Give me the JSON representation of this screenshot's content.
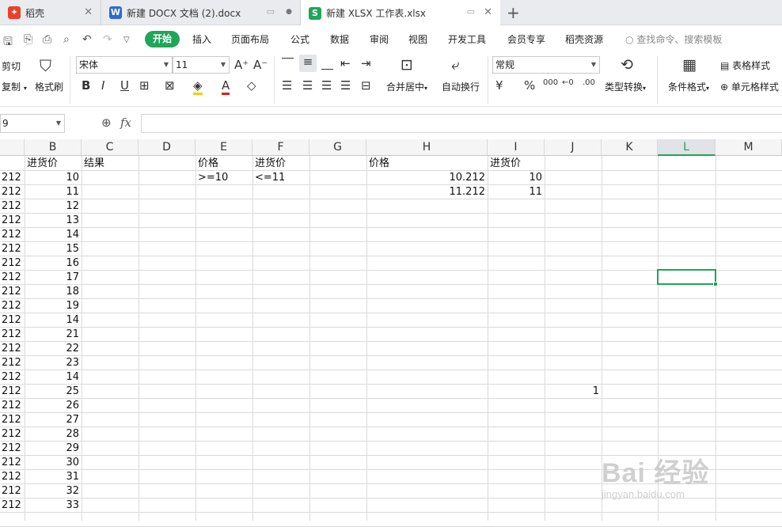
{
  "tabs": [
    {
      "label": "稻壳",
      "icon": "daoke-logo-icon",
      "color": "#e8412c"
    },
    {
      "label": "新建 DOCX 文档 (2).docx",
      "icon": "word-doc-icon",
      "color": "#2b6bd8"
    },
    {
      "label": "新建 XLSX 工作表.xlsx",
      "icon": "spreadsheet-icon",
      "color": "#1fa659"
    }
  ],
  "menu": {
    "kaishi": "开始",
    "items": [
      "插入",
      "页面布局",
      "公式",
      "数据",
      "审阅",
      "视图",
      "开发工具",
      "会员专享",
      "稻壳资源"
    ],
    "search": "查找命令、搜索模板"
  },
  "ribbon": {
    "cut": "剪切",
    "copy": "复制",
    "format_painter": "格式刷",
    "font_name": "宋体",
    "font_size": "11",
    "merge_center": "合并居中",
    "auto_wrap": "自动换行",
    "number_format": "常规",
    "type_convert": "类型转换",
    "cond_format": "条件格式",
    "table_style": "表格样式",
    "cell_style": "单元格样式"
  },
  "formula_bar": {
    "name_box": "9",
    "fx": "fx"
  },
  "columns": [
    "B",
    "C",
    "D",
    "E",
    "F",
    "G",
    "H",
    "I",
    "J",
    "K",
    "L",
    "M"
  ],
  "selected_column": "L",
  "header_row": {
    "A": "",
    "B": "进货价",
    "C": "结果",
    "E": "价格",
    "F": "进货价",
    "H": "价格",
    "I": "进货价"
  },
  "colA_values": [
    "212",
    "212",
    "212",
    "212",
    "212",
    "212",
    "212",
    "212",
    "212",
    "212",
    "212",
    "212",
    "212",
    "212",
    "212",
    "212",
    "212",
    "212",
    "212",
    "212",
    "212",
    "212",
    "212",
    "212"
  ],
  "colB_values": [
    "10",
    "11",
    "12",
    "13",
    "14",
    "15",
    "16",
    "17",
    "18",
    "19",
    "14",
    "21",
    "22",
    "23",
    "14",
    "25",
    "26",
    "27",
    "28",
    "29",
    "30",
    "31",
    "32",
    "33"
  ],
  "criteria": {
    "E2": ">=10",
    "F2": "<=11",
    "H2": "10.212",
    "I2": "10",
    "H3": "11.212",
    "I3": "11",
    "J17": "1"
  },
  "watermark": {
    "line1": "Bai 经验",
    "line2": "jingyan.baidu.com"
  }
}
